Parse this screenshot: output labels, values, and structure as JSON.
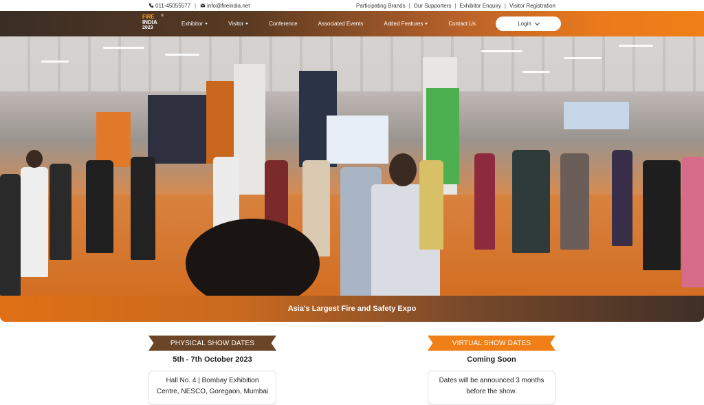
{
  "topbar": {
    "phone": "011-45055577",
    "email": "info@fireindia.net",
    "links": [
      "Participating Brands",
      "Our Supporters",
      "Exhibitor Enquiry",
      "Visitor Registration"
    ]
  },
  "logo": {
    "line1": "FIRE",
    "line2": "INDIA",
    "line3": "2023",
    "reg": "®"
  },
  "nav": {
    "items": [
      {
        "label": "Exhibitor",
        "dropdown": true
      },
      {
        "label": "Visitor",
        "dropdown": true
      },
      {
        "label": "Conference",
        "dropdown": false
      },
      {
        "label": "Associated Events",
        "dropdown": false
      },
      {
        "label": "Added Features",
        "dropdown": true
      },
      {
        "label": "Contact Us",
        "dropdown": false
      }
    ],
    "login_label": "Login"
  },
  "hero": {
    "tagline": "Asia's Largest Fire and Safety Expo"
  },
  "physical": {
    "ribbon": "PHYSICAL SHOW DATES",
    "dates": "5th - 7th October 2023",
    "venue_line1": "Hall No. 4 | Bombay Exhibition",
    "venue_line2": "Centre, NESCO, Goregaon, Mumbai"
  },
  "virtual": {
    "ribbon": "VIRTUAL SHOW DATES",
    "dates": "Coming Soon",
    "note_line1": "Dates will be announced 3 months",
    "note_line2": "before the show."
  },
  "colors": {
    "brand_orange": "#f07f17",
    "brand_brown": "#6b4528"
  },
  "icons": [
    "phone-icon",
    "envelope-icon",
    "chevron-down-icon",
    "caret-down-icon"
  ]
}
